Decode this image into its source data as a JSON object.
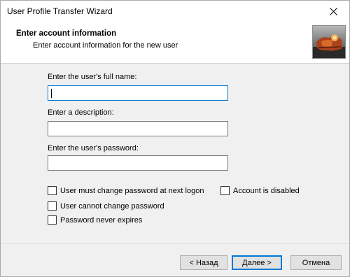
{
  "window": {
    "title": "User Profile Transfer Wizard"
  },
  "header": {
    "title": "Enter account information",
    "subtitle": "Enter account information for the new user",
    "image_icon": "wizard-banner-image"
  },
  "form": {
    "full_name": {
      "label": "Enter the user's full name:",
      "value": ""
    },
    "description": {
      "label": "Enter a description:",
      "value": ""
    },
    "password": {
      "label": "Enter the user's password:",
      "value": ""
    }
  },
  "options": {
    "must_change": {
      "label": "User must change password at next logon",
      "checked": false
    },
    "cannot_change": {
      "label": "User cannot change password",
      "checked": false
    },
    "never_expires": {
      "label": "Password never expires",
      "checked": false
    },
    "disabled": {
      "label": "Account is disabled",
      "checked": false
    }
  },
  "buttons": {
    "back": "< Назад",
    "next": "Далее >",
    "cancel": "Отмена"
  },
  "colors": {
    "focus_accent": "#0078d7",
    "header_bg": "#ffffff",
    "body_bg": "#f0f0f0"
  }
}
